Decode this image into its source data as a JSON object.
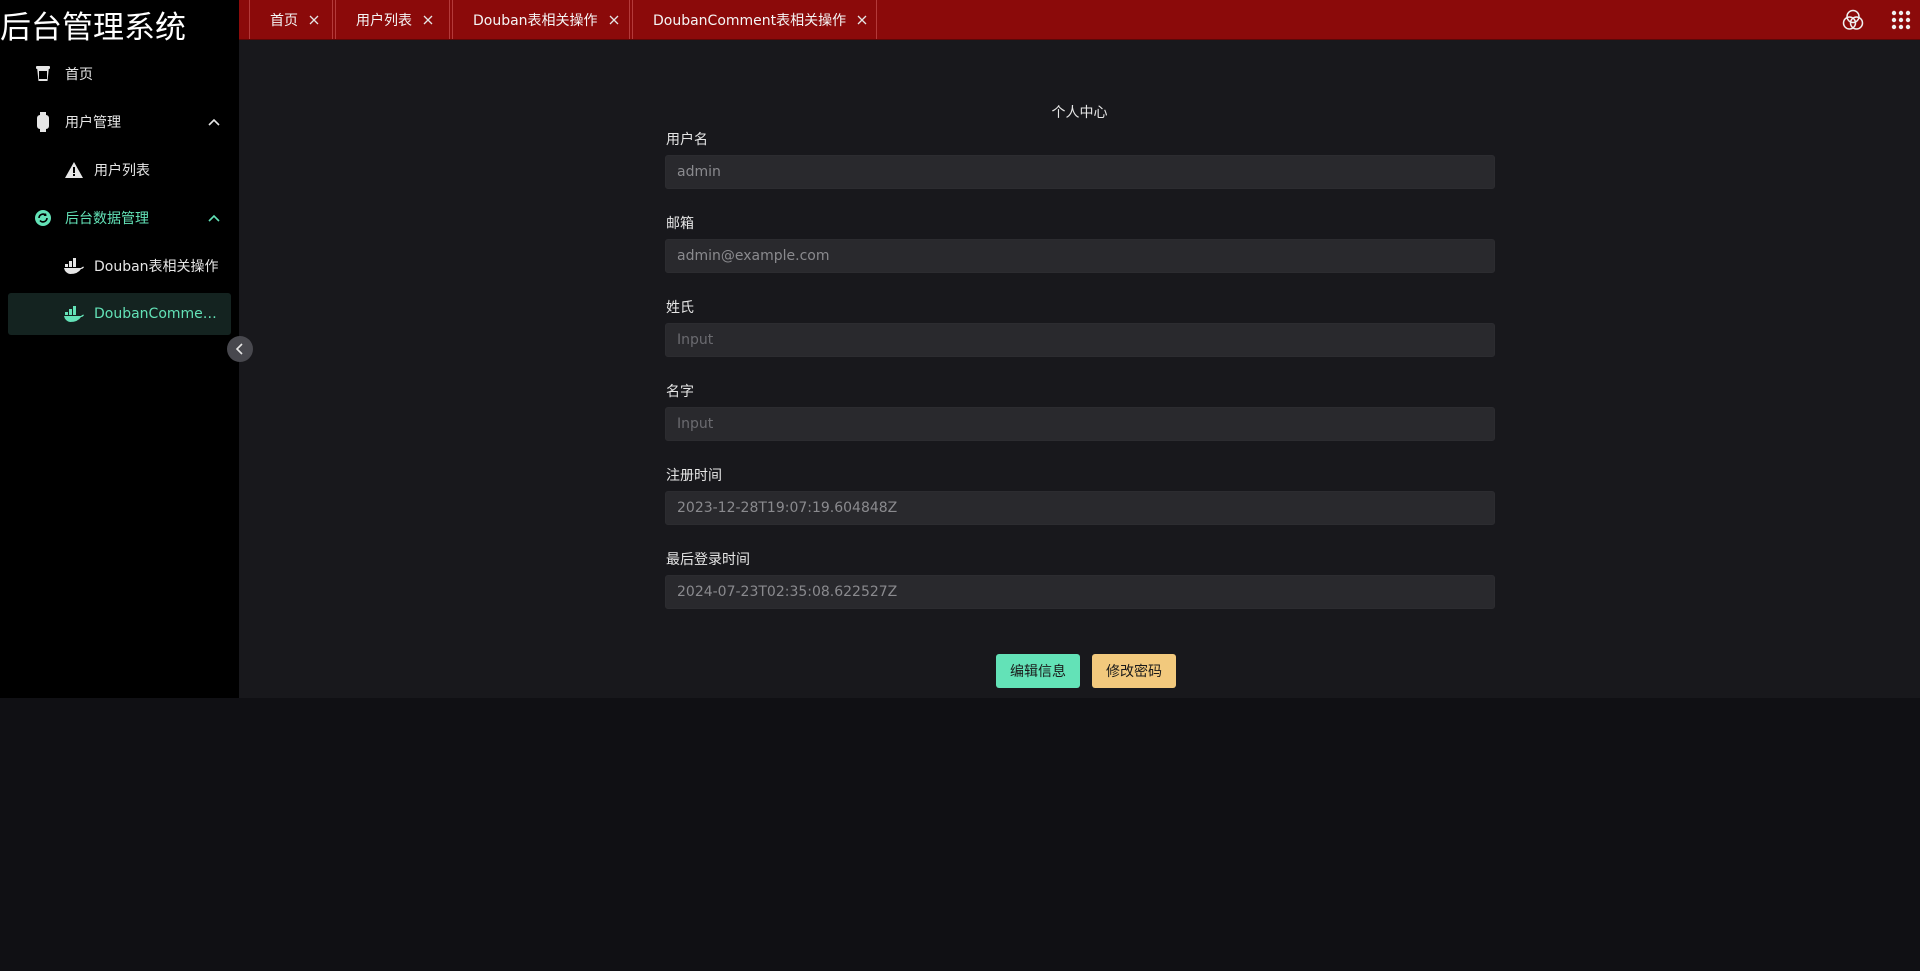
{
  "brand": "后台管理系统",
  "sidebar": {
    "items": [
      {
        "label": "首页",
        "icon": "cup-icon"
      },
      {
        "label": "用户管理",
        "icon": "watch-icon",
        "expanded": true
      },
      {
        "label": "用户列表",
        "icon": "warning-icon"
      },
      {
        "label": "后台数据管理",
        "icon": "refresh-icon",
        "expanded": true,
        "active": true
      },
      {
        "label": "Douban表相关操作",
        "icon": "docker-icon"
      },
      {
        "label": "DoubanCommen...",
        "icon": "docker-icon",
        "selected": true
      }
    ]
  },
  "tabs": [
    {
      "label": "首页"
    },
    {
      "label": "用户列表"
    },
    {
      "label": "Douban表相关操作"
    },
    {
      "label": "DoubanComment表相关操作",
      "active": true
    }
  ],
  "header_icons": [
    "color-circles-icon",
    "app-grid-icon"
  ],
  "form": {
    "title": "个人中心",
    "fields": [
      {
        "label": "用户名",
        "value": "admin"
      },
      {
        "label": "邮箱",
        "value": "admin@example.com"
      },
      {
        "label": "姓氏",
        "placeholder": "Input"
      },
      {
        "label": "名字",
        "placeholder": "Input"
      },
      {
        "label": "注册时间",
        "value": "2023-12-28T19:07:19.604848Z"
      },
      {
        "label": "最后登录时间",
        "value": "2024-07-23T02:35:08.622527Z"
      }
    ],
    "edit_button": "编辑信息",
    "password_button": "修改密码"
  },
  "colors": {
    "accent": "#63e2b7",
    "tabbar": "#8b0a0a",
    "warning_button": "#f2c97d"
  }
}
